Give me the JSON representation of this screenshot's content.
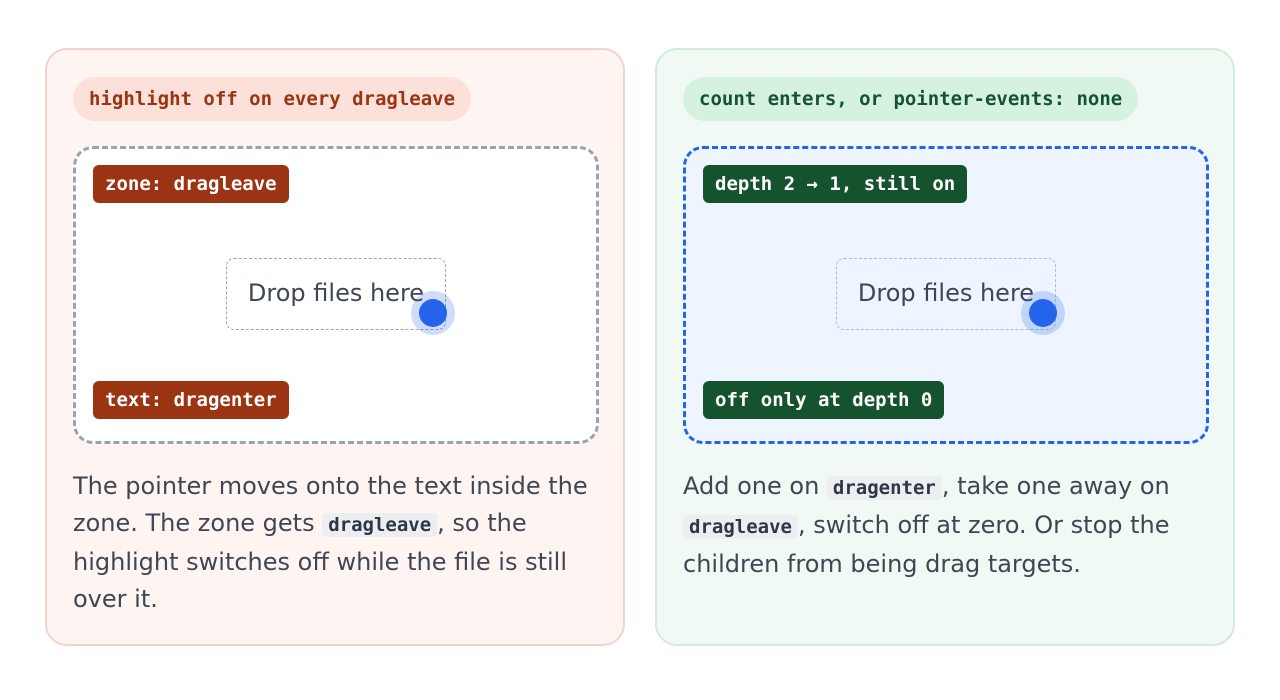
{
  "panels": [
    {
      "pill": "highlight off on every dragleave",
      "top_tag": "zone: dragleave",
      "bottom_tag": "text: dragenter",
      "drop_text": "Drop files here",
      "caption": {
        "part1": "The pointer moves onto the text inside the zone. The zone gets ",
        "code1": "dragleave",
        "part2": ", so the highlight switches off while the file is still over it."
      },
      "zone_highlighted": false
    },
    {
      "pill": "count enters, or pointer-events: none",
      "top_tag": "depth 2 → 1, still on",
      "bottom_tag": "off only at depth 0",
      "drop_text": "Drop files here",
      "caption": {
        "part1": "Add one on ",
        "code1": "dragenter",
        "part2": ", take one away on ",
        "code2": "dragleave",
        "part3": ", switch off at zero. Or stop the children from being drag targets."
      },
      "zone_highlighted": true
    }
  ],
  "colors": {
    "bad_accent": "#9a3412",
    "good_accent": "#14532d",
    "pointer": "#2563eb",
    "highlight_border": "#2563eb"
  }
}
